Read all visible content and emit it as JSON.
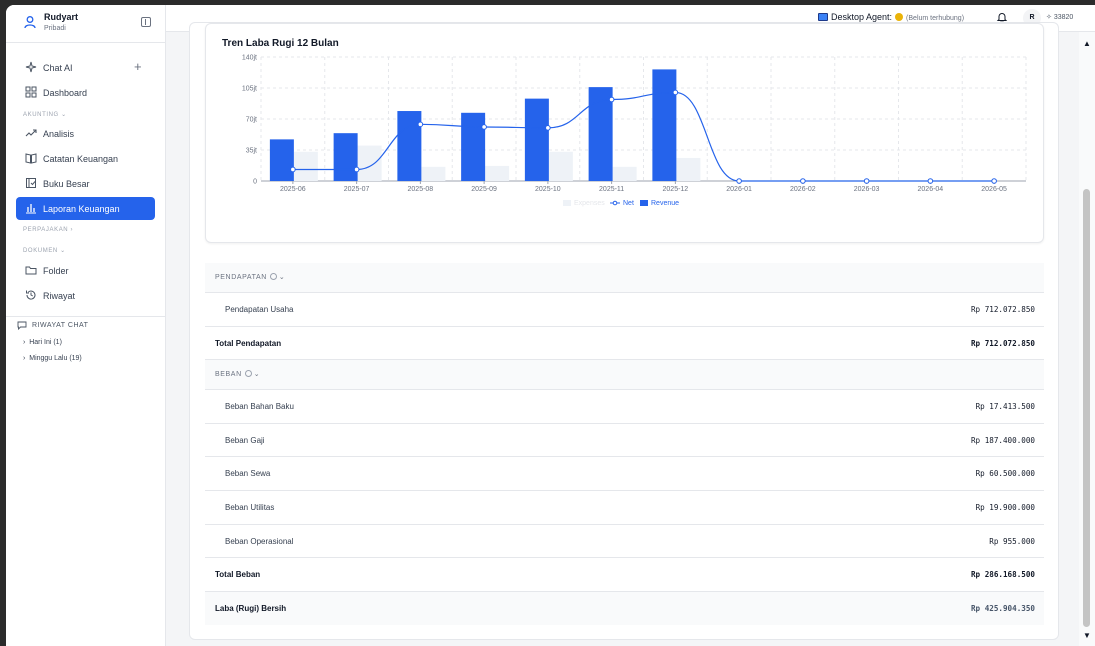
{
  "user": {
    "name": "Rudyart",
    "subtitle": "Pribadi"
  },
  "nav": {
    "chat": "Chat AI",
    "dashboard": "Dashboard",
    "section_akunting": "AKUNTING ⌄",
    "analisis": "Analisis",
    "catatan": "Catatan Keuangan",
    "buku": "Buku Besar",
    "laporan": "Laporan Keuangan",
    "section_perpajakan": "PERPAJAKAN ›",
    "section_dokumen": "DOKUMEN ⌄",
    "folder": "Folder",
    "riwayat": "Riwayat"
  },
  "history": {
    "title": "RIWAYAT CHAT",
    "items": [
      "Hari Ini (1)",
      "Minggu Lalu (19)"
    ]
  },
  "topbar": {
    "agent_label": "Desktop Agent:",
    "agent_status": "(Belum terhubung)",
    "avatar_initial": "R",
    "credits": "33820"
  },
  "chart_data": {
    "type": "bar",
    "title": "Tren Laba Rugi 12 Bulan",
    "categories": [
      "2025-06",
      "2025-07",
      "2025-08",
      "2025-09",
      "2025-10",
      "2025-11",
      "2025-12",
      "2026-01",
      "2026-02",
      "2026-03",
      "2026-04",
      "2026-05"
    ],
    "y_ticks": [
      "0",
      "35jt",
      "70jt",
      "105jt",
      "140jt"
    ],
    "ylim": [
      0,
      140
    ],
    "series": [
      {
        "name": "Expenses",
        "kind": "bar",
        "color": "#eef2f7",
        "values": [
          33,
          40,
          16,
          17,
          33,
          16,
          26,
          0,
          0,
          0,
          0,
          0
        ]
      },
      {
        "name": "Net",
        "kind": "line",
        "color": "#2563eb",
        "values": [
          13,
          13,
          64,
          61,
          60,
          92,
          100,
          0,
          0,
          0,
          0,
          0
        ]
      },
      {
        "name": "Revenue",
        "kind": "bar",
        "color": "#2563eb",
        "values": [
          47,
          54,
          79,
          77,
          93,
          106,
          126,
          0,
          0,
          0,
          0,
          0
        ]
      }
    ],
    "legend": [
      "Expenses",
      "Net",
      "Revenue"
    ],
    "legend_position": "bottom",
    "grid": true
  },
  "report": {
    "pendapatan_header": "PENDAPATAN",
    "pendapatan_rows": [
      {
        "label": "Pendapatan Usaha",
        "value": "Rp 712.072.850"
      }
    ],
    "total_pendapatan": {
      "label": "Total Pendapatan",
      "value": "Rp 712.072.850"
    },
    "beban_header": "BEBAN",
    "beban_rows": [
      {
        "label": "Beban Bahan Baku",
        "value": "Rp 17.413.500"
      },
      {
        "label": "Beban Gaji",
        "value": "Rp 187.400.000"
      },
      {
        "label": "Beban Sewa",
        "value": "Rp 60.500.000"
      },
      {
        "label": "Beban Utilitas",
        "value": "Rp 19.900.000"
      },
      {
        "label": "Beban Operasional",
        "value": "Rp 955.000"
      }
    ],
    "total_beban": {
      "label": "Total Beban",
      "value": "Rp 286.168.500"
    },
    "laba": {
      "label": "Laba (Rugi) Bersih",
      "value": "Rp 425.904.350"
    }
  },
  "colors": {
    "accent": "#2563eb",
    "status_dot": "#eab308"
  }
}
